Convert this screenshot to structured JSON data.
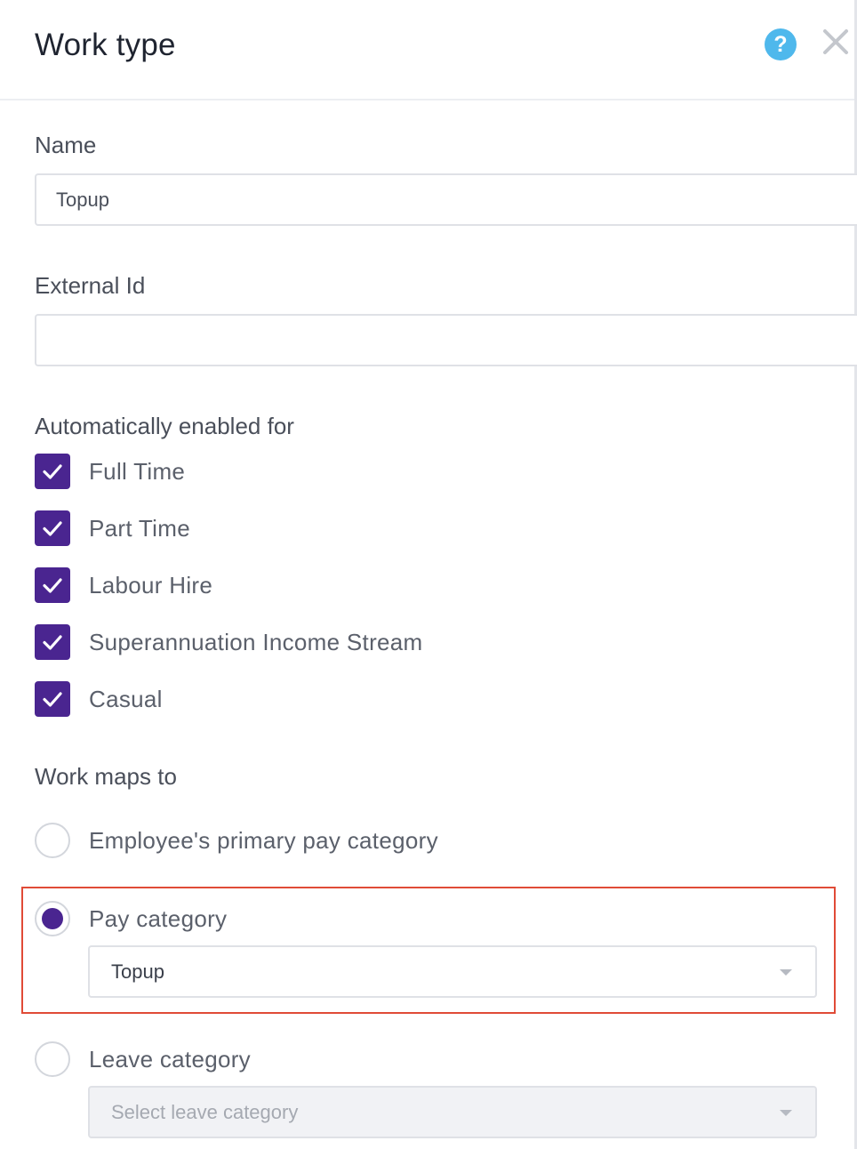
{
  "header": {
    "title": "Work type",
    "help_icon": "question-circle-icon",
    "help_glyph": "?",
    "close_icon": "close-icon"
  },
  "name_field": {
    "label": "Name",
    "value": "Topup"
  },
  "external_id_field": {
    "label": "External Id",
    "value": ""
  },
  "auto_enabled": {
    "label": "Automatically enabled for",
    "options": [
      {
        "label": "Full Time",
        "checked": true
      },
      {
        "label": "Part Time",
        "checked": true
      },
      {
        "label": "Labour Hire",
        "checked": true
      },
      {
        "label": "Superannuation Income Stream",
        "checked": true
      },
      {
        "label": "Casual",
        "checked": true
      }
    ]
  },
  "work_maps_to": {
    "label": "Work maps to",
    "options": [
      {
        "label": "Employee's primary pay category",
        "selected": false
      },
      {
        "label": "Pay category",
        "selected": true,
        "select_value": "Topup"
      },
      {
        "label": "Leave category",
        "selected": false,
        "select_placeholder": "Select leave category"
      }
    ]
  },
  "colors": {
    "accent": "#4a2590",
    "help": "#4fb8ec",
    "highlight": "#e04b37"
  }
}
